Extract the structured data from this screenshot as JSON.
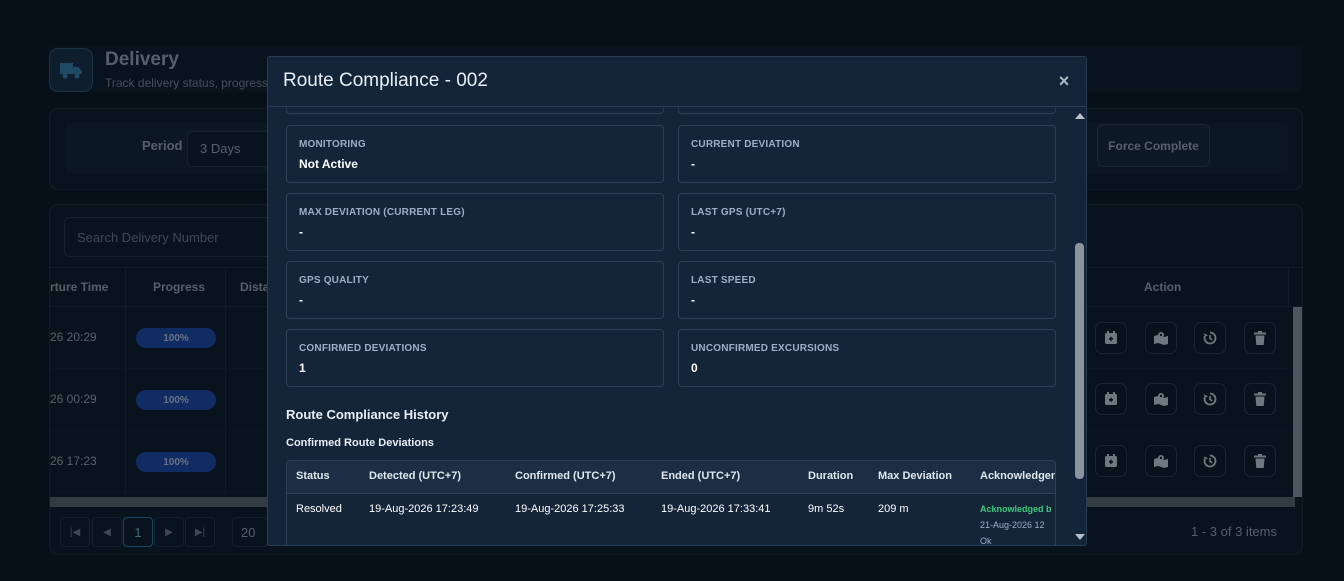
{
  "page": {
    "title": "Delivery",
    "subtitle": "Track delivery status, progress",
    "icon": "truck-icon"
  },
  "filters": {
    "period_label": "Period",
    "period_value": "3 Days",
    "force_complete_label": "Force Complete"
  },
  "table": {
    "search_placeholder": "Search Delivery Number",
    "headers": {
      "departure_time": "rture Time",
      "progress": "Progress",
      "distance": "Distan",
      "action": "Action"
    },
    "rows": [
      {
        "departure_time": "26 20:29",
        "progress": "100%"
      },
      {
        "departure_time": "26 00:29",
        "progress": "100%"
      },
      {
        "departure_time": "26 17:23",
        "progress": "100%"
      }
    ],
    "action_icons": [
      "calendar-icon",
      "map-icon",
      "history-icon",
      "trash-icon"
    ]
  },
  "pagination": {
    "current_page": "1",
    "page_size": "20",
    "items_info": "1 - 3 of 3 items"
  },
  "modal": {
    "title": "Route Compliance - 002",
    "close_label": "×",
    "cards": [
      {
        "label": "MONITORING",
        "value": "Not Active"
      },
      {
        "label": "CURRENT DEVIATION",
        "value": "-"
      },
      {
        "label": "MAX DEVIATION (CURRENT LEG)",
        "value": "-"
      },
      {
        "label": "LAST GPS (UTC+7)",
        "value": "-"
      },
      {
        "label": "GPS QUALITY",
        "value": "-"
      },
      {
        "label": "LAST SPEED",
        "value": "-"
      },
      {
        "label": "CONFIRMED DEVIATIONS",
        "value": "1"
      },
      {
        "label": "UNCONFIRMED EXCURSIONS",
        "value": "0"
      }
    ],
    "history_title": "Route Compliance History",
    "confirmed_title": "Confirmed Route Deviations",
    "deviation_headers": {
      "status": "Status",
      "detected": "Detected (UTC+7)",
      "confirmed": "Confirmed (UTC+7)",
      "ended": "Ended (UTC+7)",
      "duration": "Duration",
      "max_deviation": "Max Deviation",
      "acknowledgement": "Acknowledgen"
    },
    "deviation_row": {
      "status": "Resolved",
      "detected": "19-Aug-2026 17:23:49",
      "confirmed": "19-Aug-2026 17:25:33",
      "ended": "19-Aug-2026 17:33:41",
      "duration": "9m 52s",
      "max_deviation": "209 m",
      "ack_status": "Acknowledged b",
      "ack_date": "21-Aug-2026 12",
      "ack_note": "Ok"
    }
  },
  "colors": {
    "background": "#0b1522",
    "modal_background": "#14253a",
    "progress_badge": "#1e4aa8",
    "acknowledged": "#3fc97a"
  }
}
